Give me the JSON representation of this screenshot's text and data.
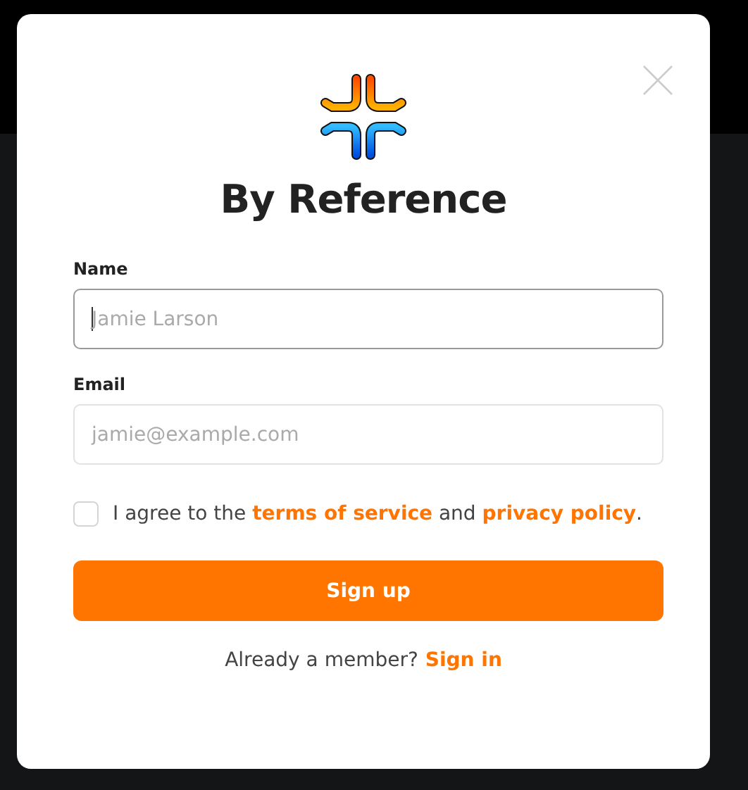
{
  "dialog": {
    "title": "By Reference"
  },
  "fields": [
    {
      "label": "Name",
      "placeholder": "Jamie Larson",
      "focused": true
    },
    {
      "label": "Email",
      "placeholder": "jamie@example.com",
      "focused": false
    }
  ],
  "agreement": {
    "checked": false,
    "parts": [
      {
        "kind": "text",
        "text": "I agree to the "
      },
      {
        "kind": "link",
        "text": "terms of service"
      },
      {
        "kind": "text",
        "text": " and "
      },
      {
        "kind": "link",
        "text": "privacy policy"
      },
      {
        "kind": "text",
        "text": "."
      }
    ]
  },
  "submit": {
    "label": "Sign up"
  },
  "footer": {
    "text": "Already a member?",
    "link": "Sign in"
  }
}
